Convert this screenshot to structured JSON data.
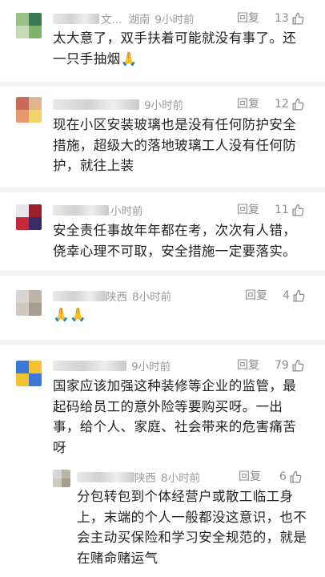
{
  "comments": [
    {
      "location": "湖南",
      "name_suffix": "文...",
      "time": "9小时前",
      "reply_label": "回复",
      "likes": "13",
      "text": "太大意了，双手扶着可能就没有事了。还一只手抽烟🙏"
    },
    {
      "location": "",
      "name_suffix": "",
      "time": "9小时前",
      "reply_label": "回复",
      "likes": "12",
      "text": "现在小区安装玻璃也是没有任何防护安全措施，超级大的落地玻璃工人没有任何防护，就往上装"
    },
    {
      "location": "",
      "name_suffix": "",
      "time": "小时前",
      "reply_label": "回复",
      "likes": "11",
      "text": "安全责任事故年年都在考，次次有人错，侥幸心理不可取，安全措施一定要落实。"
    },
    {
      "location": "陕西",
      "name_suffix": "",
      "time": "8小时前",
      "reply_label": "回复",
      "likes": "4",
      "text": "🙏🙏"
    },
    {
      "location": "",
      "name_suffix": "",
      "time": "9小时前",
      "reply_label": "回复",
      "likes": "79",
      "text": "国家应该加强这种装修等企业的监管，最起码给员工的意外险等要购买呀。一出事，给个人、家庭、社会带来的危害痛苦呀"
    },
    {
      "location": "陕西",
      "name_suffix": "",
      "time": "8小时前",
      "reply_label": "回复",
      "likes": "6",
      "text": "分包转包到个体经营户或散工临工身上，末端的个人一般都没这意识，也不会主动买保险和学习安全规范的，就是在赌命赌运气"
    }
  ],
  "colors": {
    "text": "#222222",
    "meta": "#9a9a9a",
    "divider": "#f3f3f3"
  },
  "icons": {
    "like": "thumbs-up-icon"
  }
}
